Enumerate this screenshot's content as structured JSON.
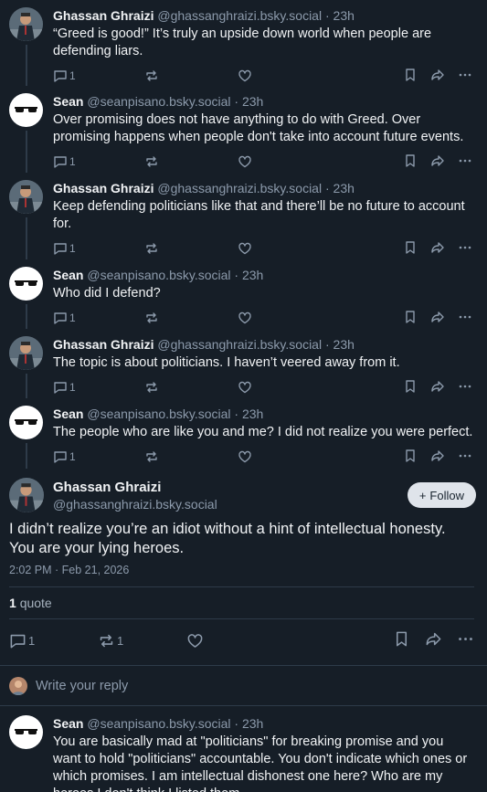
{
  "thread": [
    {
      "avatar": "suited-man-avatar",
      "name": "Ghassan Ghraizi",
      "handle": "@ghassanghraizi.bsky.social",
      "time": "23h",
      "text": "“Greed is good!” It’s truly an upside down world when people are defending liars.",
      "reply_count": "1"
    },
    {
      "avatar": "glasses-avatar",
      "name": "Sean",
      "handle": "@seanpisano.bsky.social",
      "time": "23h",
      "text": "Over promising does not have anything to do with Greed. Over promising happens when people don't take into account future events.",
      "reply_count": "1"
    },
    {
      "avatar": "suited-man-avatar",
      "name": "Ghassan Ghraizi",
      "handle": "@ghassanghraizi.bsky.social",
      "time": "23h",
      "text": "Keep defending politicians like that and there’ll be no future to account for.",
      "reply_count": "1"
    },
    {
      "avatar": "glasses-avatar",
      "name": "Sean",
      "handle": "@seanpisano.bsky.social",
      "time": "23h",
      "text": "Who did I defend?",
      "reply_count": "1"
    },
    {
      "avatar": "suited-man-avatar",
      "name": "Ghassan Ghraizi",
      "handle": "@ghassanghraizi.bsky.social",
      "time": "23h",
      "text": "The topic is about politicians. I haven’t veered away from it.",
      "reply_count": "1"
    },
    {
      "avatar": "glasses-avatar",
      "name": "Sean",
      "handle": "@seanpisano.bsky.social",
      "time": "23h",
      "text": "The people who are like you and me? I did not realize you were perfect.",
      "reply_count": "1"
    }
  ],
  "focus": {
    "name": "Ghassan Ghraizi",
    "handle": "@ghassanghraizi.bsky.social",
    "follow_label": "Follow",
    "text": "I didn’t realize you’re an idiot without a hint of intellectual honesty. You are your lying heroes.",
    "date": "2:02 PM · Feb 21, 2026",
    "quote_count": "1",
    "quote_label": "quote",
    "reply_count": "1",
    "repost_count": "1"
  },
  "reply_bar": {
    "placeholder": "Write your reply"
  },
  "reply": {
    "name": "Sean",
    "handle": "@seanpisano.bsky.social",
    "time": "23h",
    "text": "You are basically mad at \"politicians\"  for breaking promise and you want to hold  \"politicians\" accountable. You don't indicate which ones or which promises.  I am intellectual dishonest one here? Who are my heroes I don't think I listed them."
  },
  "colors": {
    "background": "#161e27",
    "muted": "#8c9aab",
    "line": "#2e3b49"
  }
}
